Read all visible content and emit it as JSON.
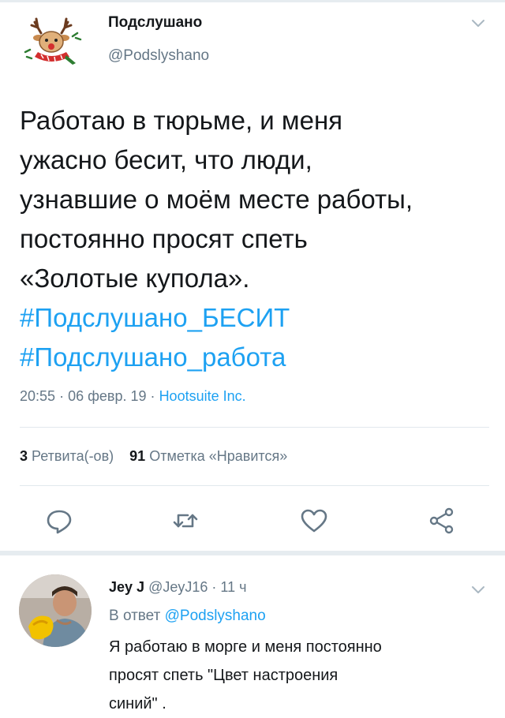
{
  "tweet": {
    "author_name": "Подслушано",
    "author_handle": "@Podslyshano",
    "text_lines": [
      "Работаю в тюрьме, и меня",
      "ужасно бесит, что люди,",
      "узнавшие о моём месте работы,",
      "постоянно просят спеть",
      "«Золотые купола»."
    ],
    "hashtags": [
      "#Подслушано_БЕСИТ",
      "#Подслушано_работа"
    ],
    "time": "20:55",
    "date": "06 февр. 19",
    "dot": "·",
    "source": "Hootsuite Inc.",
    "retweets_count": "3",
    "retweets_label": "Ретвита(-ов)",
    "likes_count": "91",
    "likes_label": "Отметка «Нравится»"
  },
  "reply": {
    "name": "Jey J",
    "handle": "@JeyJ16",
    "dot": "·",
    "time": "11 ч",
    "reply_prefix": "В ответ",
    "reply_mention": "@Podslyshano",
    "text_lines": [
      "Я работаю в морге и меня постоянно",
      "просят спеть \"Цвет настроения",
      "синий\" ."
    ]
  },
  "icons": {
    "reply": "reply-icon",
    "retweet": "retweet-icon",
    "like": "heart-icon",
    "share": "share-icon",
    "more": "chevron-down-icon"
  },
  "colors": {
    "accent": "#1da1f2",
    "secondary_text": "#657786",
    "primary_text": "#14171a",
    "divider": "#e1e8ed"
  }
}
